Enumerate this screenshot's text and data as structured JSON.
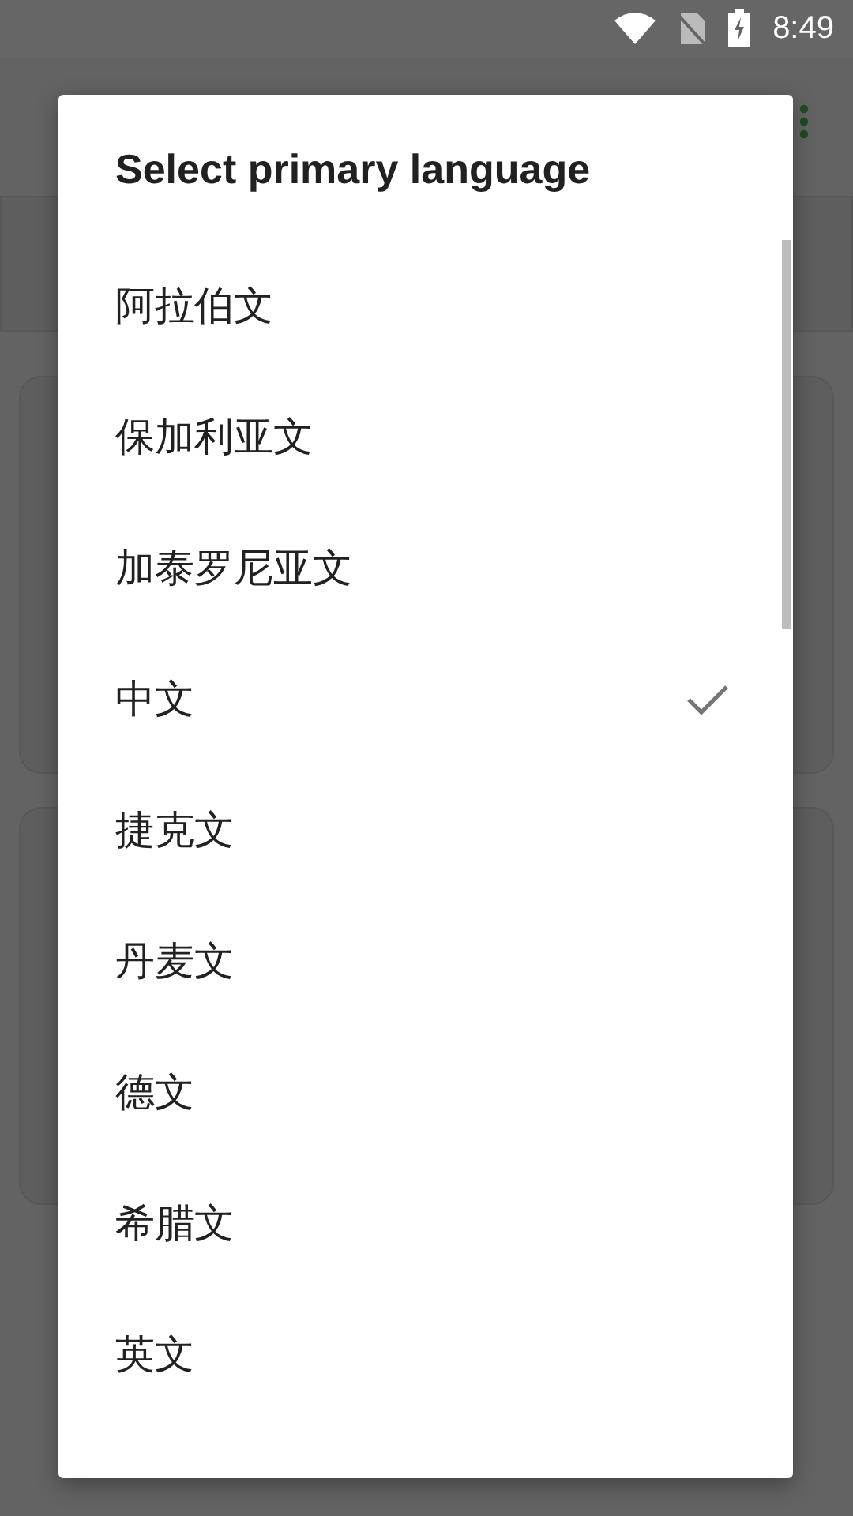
{
  "status_bar": {
    "time": "8:49"
  },
  "dialog": {
    "title": "Select primary language",
    "options": [
      {
        "label": "阿拉伯文",
        "selected": false
      },
      {
        "label": "保加利亚文",
        "selected": false
      },
      {
        "label": "加泰罗尼亚文",
        "selected": false
      },
      {
        "label": "中文",
        "selected": true
      },
      {
        "label": "捷克文",
        "selected": false
      },
      {
        "label": "丹麦文",
        "selected": false
      },
      {
        "label": "德文",
        "selected": false
      },
      {
        "label": "希腊文",
        "selected": false
      },
      {
        "label": "英文",
        "selected": false
      }
    ]
  }
}
